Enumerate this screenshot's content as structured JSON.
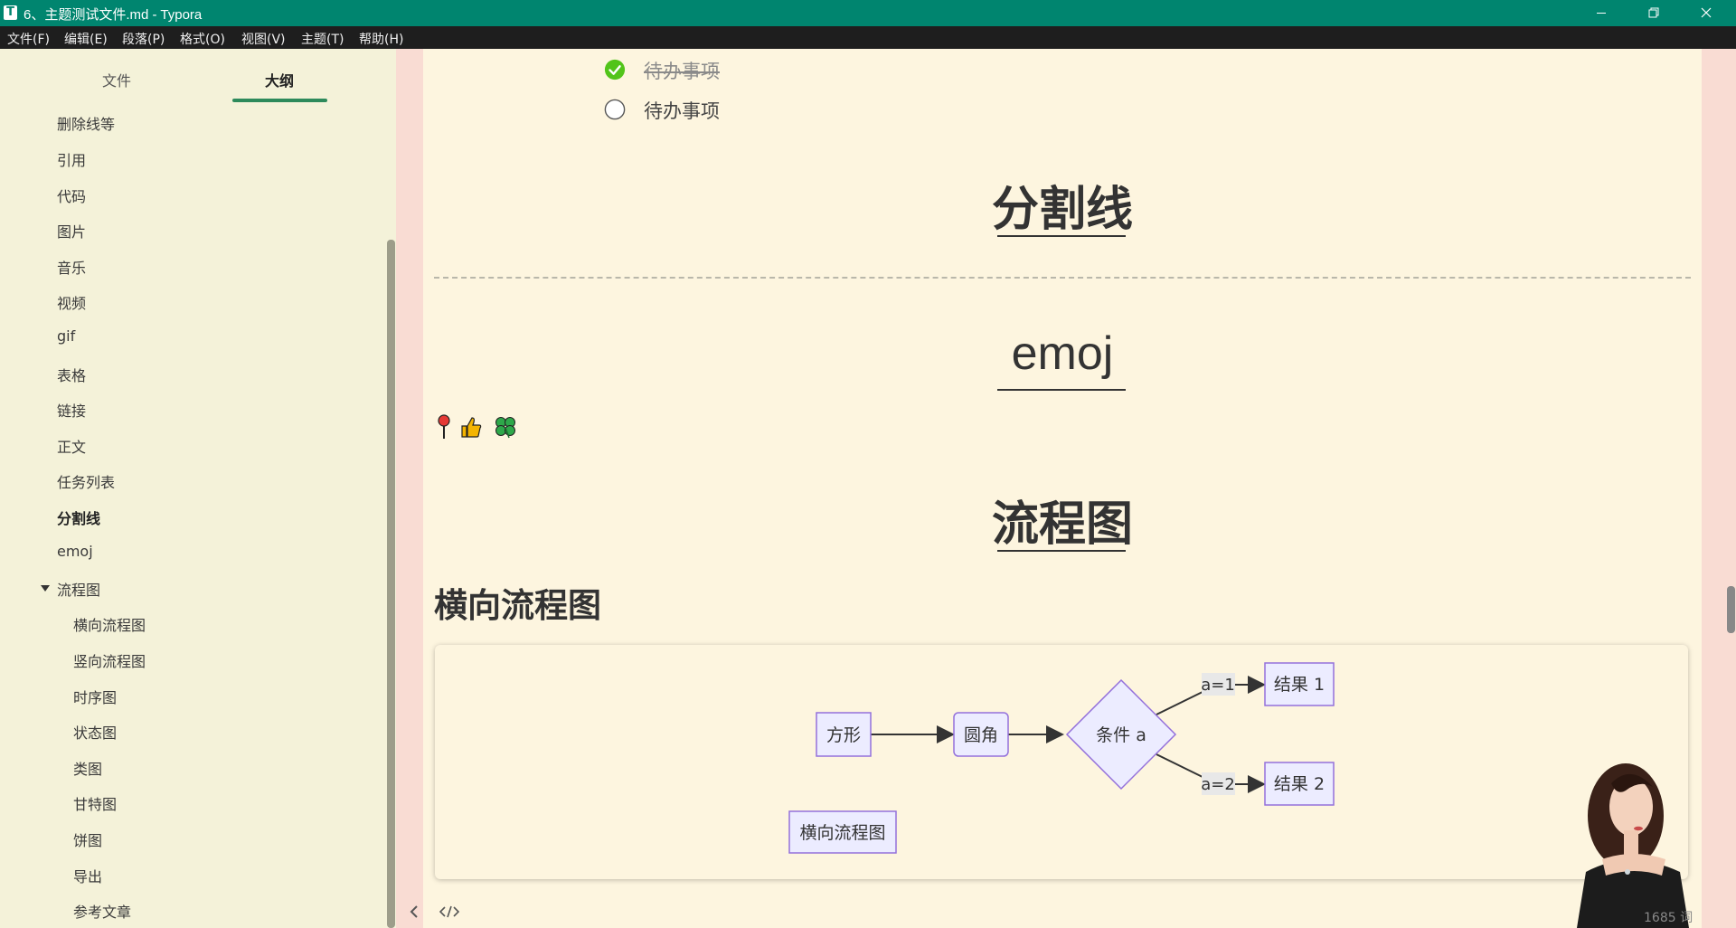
{
  "window": {
    "title": "6、主题测试文件.md - Typora",
    "app_icon_letter": "T"
  },
  "menu": [
    "文件(F)",
    "编辑(E)",
    "段落(P)",
    "格式(O)",
    "视图(V)",
    "主题(T)",
    "帮助(H)"
  ],
  "sidebar": {
    "tabs": [
      "文件",
      "大纲"
    ],
    "active_tab": "大纲",
    "outline": [
      "删除线等",
      "引用",
      "代码",
      "图片",
      "音乐",
      "视频",
      "gif",
      "表格",
      "链接",
      "正文",
      "任务列表",
      "分割线",
      "emoj",
      "流程图"
    ],
    "outline_children": [
      "横向流程图",
      "竖向流程图",
      "时序图",
      "状态图",
      "类图",
      "甘特图",
      "饼图",
      "导出",
      "参考文章"
    ],
    "active_item": "分割线"
  },
  "document": {
    "tasks": [
      {
        "label": "待办事项",
        "done": true
      },
      {
        "label": "待办事项",
        "done": false
      }
    ],
    "heading_divider": "分割线",
    "heading_emoji": "emoj",
    "heading_flowchart": "流程图",
    "subheading_horizontal": "横向流程图",
    "flowchart": {
      "node_square": "方形",
      "node_round": "圆角",
      "node_condition": "条件 a",
      "edge_label_1": "a=1",
      "edge_label_2": "a=2",
      "node_result_1": "结果 1",
      "node_result_2": "结果 2",
      "caption": "横向流程图"
    }
  },
  "status": {
    "word_count": "1685 词"
  },
  "colors": {
    "accent": "#00856f",
    "tab_underline": "#2d8a5b",
    "node_fill": "#ececff",
    "node_stroke": "#9370db",
    "check_green": "#52c41a"
  }
}
